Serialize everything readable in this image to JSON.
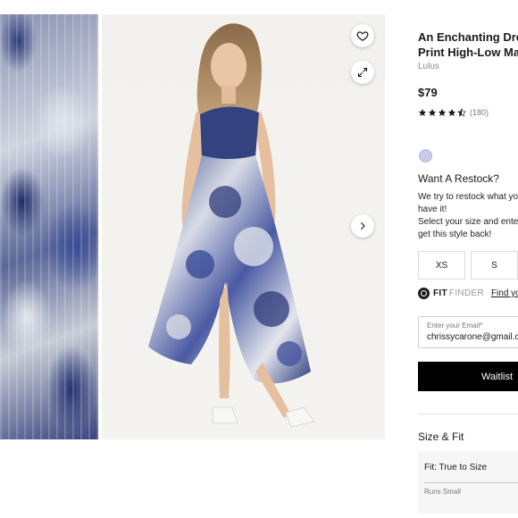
{
  "product": {
    "title_line1": "An Enchanting Dre",
    "title_line2": "Print High-Low Max",
    "brand": "Lulus",
    "price": "$79",
    "rating_stars": 4.5,
    "review_count": "(180)"
  },
  "colors": {
    "swatch": "#c9c9ea",
    "button_bg": "#000000"
  },
  "restock": {
    "title": "Want A Restock?",
    "line1": "We try to restock what yo",
    "line2": "have it!",
    "line3": "Select your size and ente",
    "line4": "get this style back!"
  },
  "sizes": [
    "XS",
    "S"
  ],
  "fit_finder": {
    "brand_bold": "FIT",
    "brand_light": "FINDER",
    "link": "Find your"
  },
  "email": {
    "label": "Enter your Email*",
    "value": "chrissycarone@gmail.c"
  },
  "waitlist_label": "Waitlist",
  "size_fit": {
    "title": "Size & Fit",
    "fit_label": "Fit: True to Size",
    "fit_sub": "Runs Small"
  },
  "icons": {
    "favorite": "heart-icon",
    "expand": "expand-icon",
    "next": "chevron-right-icon"
  }
}
